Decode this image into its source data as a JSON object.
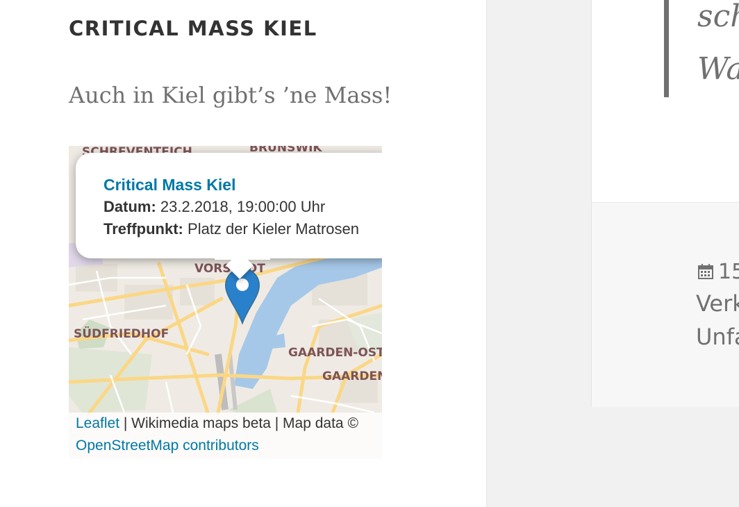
{
  "site": {
    "title": "CRITICAL MASS KIEL",
    "tagline": "Auch in Kiel gibt’s ’ne Mass!"
  },
  "map": {
    "labels": {
      "schreventeich": "SCHREVENTEICH",
      "brunswik": "BRUNSWIK",
      "vorstadt": "VORSTADT",
      "suedfriedhof": "SÜDFRIEDHOF",
      "gaarden_ost": "GAARDEN-OST",
      "gaarden": "GAARDEN"
    },
    "popup": {
      "title": "Critical Mass Kiel",
      "datum_label": "Datum:",
      "datum_value": "23.2.2018, 19:00:00 Uhr",
      "treffpunkt_label": "Treffpunkt:",
      "treffpunkt_value": "Platz der Kieler Matrosen"
    },
    "attribution": {
      "leaflet": "Leaflet",
      "separator1": " | Wikimedia maps beta | Map data © ",
      "osm": "OpenStreetMap contributors"
    }
  },
  "article": {
    "quote_line1": "sch",
    "quote_line2": "Wa",
    "meta_date": "15",
    "meta_line1": "Verk",
    "meta_line2": "Unfa"
  },
  "colors": {
    "link": "#0078a8",
    "marker": "#2a81cb",
    "water": "#a6c8e8",
    "road": "#fbd785"
  }
}
